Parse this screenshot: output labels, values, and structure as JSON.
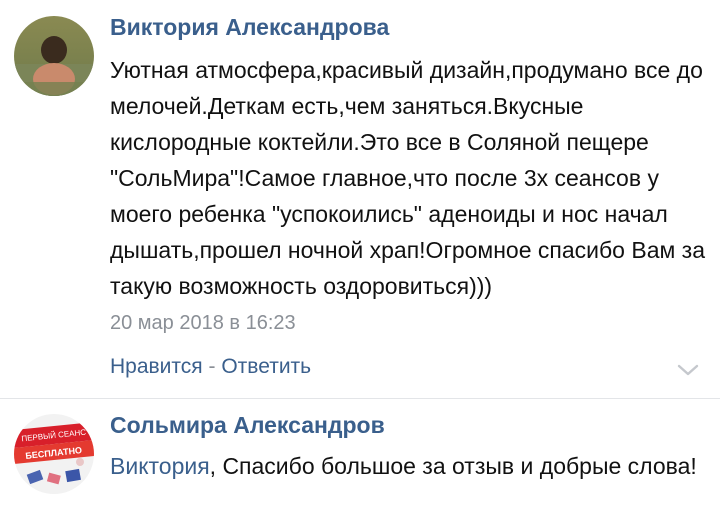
{
  "comments": [
    {
      "author": "Виктория Александрова",
      "text": "Уютная атмосфера,красивый дизайн,продумано все до мелочей.Деткам есть,чем заняться.Вкусные кислородные коктейли.Это все в Соляной пещере \"СольМира\"!Самое главное,что после 3х сеансов у моего ребенка \"успокоились\" аденоиды и нос начал дышать,прошел ночной храп!Огромное спасибо Вам за такую возможность оздоровиться)))",
      "date": "20 мар 2018 в 16:23",
      "like_label": "Нравится",
      "separator": " - ",
      "reply_label": "Ответить",
      "menu_icon": "chevron-down-icon"
    },
    {
      "author": "Сольмира Александров",
      "mention": "Виктория",
      "text": ", Спасибо большое за отзыв и добрые слова!",
      "avatar_badge_line1": "ПЕРВЫЙ СЕАНС",
      "avatar_badge_line2": "БЕСПЛАТНО"
    }
  ],
  "colors": {
    "link": "#3a5f8c",
    "meta": "#8a8f96",
    "text": "#111111",
    "badge": "#d81f2a"
  }
}
